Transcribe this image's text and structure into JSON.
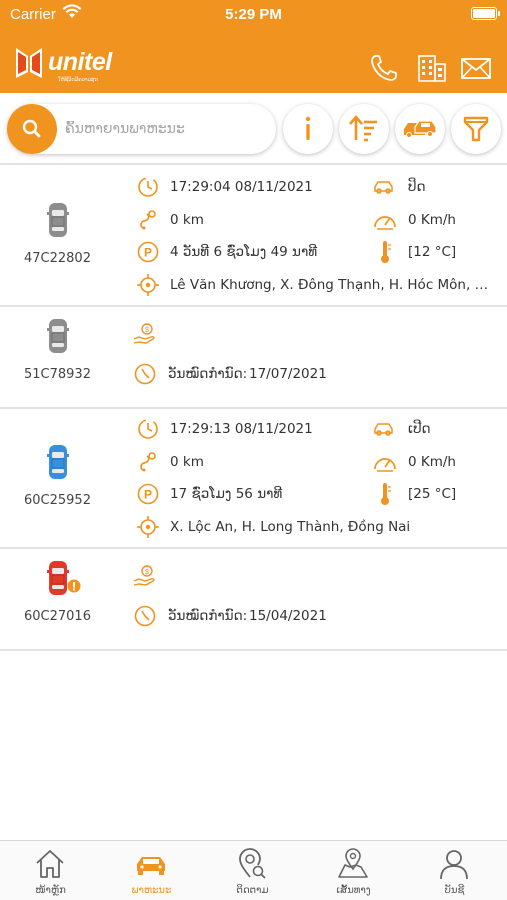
{
  "status_bar": {
    "carrier": "Carrier",
    "time": "5:29 PM"
  },
  "header": {
    "logo_text": "unitel",
    "logo_subtext": "ໃຫ້ຊີວິດມີຄວາມສຸກ",
    "icons": [
      "phone-icon",
      "building-icon",
      "mail-icon"
    ]
  },
  "search": {
    "placeholder": "ຄົ້ນຫາຍານພາຫະນະ"
  },
  "toolbar_buttons": [
    "info-icon",
    "sort-icon",
    "vehicles-icon",
    "filter-icon"
  ],
  "vehicles": [
    {
      "plate": "47C22802",
      "car_color": "#8d8d8d",
      "time": "17:29:04 08/11/2021",
      "engine": "ປິດ",
      "distance": "0 km",
      "speed": "0 Km/h",
      "parked": "4 ວັນທີ 6 ຊົ່ວໂມງ 49 ນາທີ",
      "temperature": "[12 °C]",
      "address": "Lê Văn Khương, X. Đông Thạnh, H. Hóc Môn, TP. Hồ Chí Minh"
    },
    {
      "plate": "51C78932",
      "car_color": "#8d8d8d",
      "expiry_label": "ວັນໝົດກຳນົດ:",
      "expiry_date": "17/07/2021"
    },
    {
      "plate": "60C25952",
      "car_color": "#3a8fdc",
      "time": "17:29:13 08/11/2021",
      "engine": "ເປີດ",
      "distance": "0 km",
      "speed": "0 Km/h",
      "parked": "17 ຊົ່ວໂມງ 56 ນາທີ",
      "temperature": "[25 °C]",
      "address": "X. Lộc An, H. Long Thành, Đồng Nai"
    },
    {
      "plate": "60C27016",
      "car_color": "#e03a2a",
      "expiry_label": "ວັນໝົດກຳນົດ:",
      "expiry_date": "15/04/2021"
    }
  ],
  "tabs": [
    {
      "label": "ໜ້າຫຼັກ",
      "icon": "home-icon",
      "active": false
    },
    {
      "label": "ພາຫະນະ",
      "icon": "car-icon",
      "active": true
    },
    {
      "label": "ຕິດຕາມ",
      "icon": "track-icon",
      "active": false
    },
    {
      "label": "ເສັ້ນທາງ",
      "icon": "route-icon",
      "active": false
    },
    {
      "label": "ບັນຊີ",
      "icon": "account-icon",
      "active": false
    }
  ],
  "colors": {
    "accent": "#f0931f",
    "divider": "#e2e2e2"
  }
}
